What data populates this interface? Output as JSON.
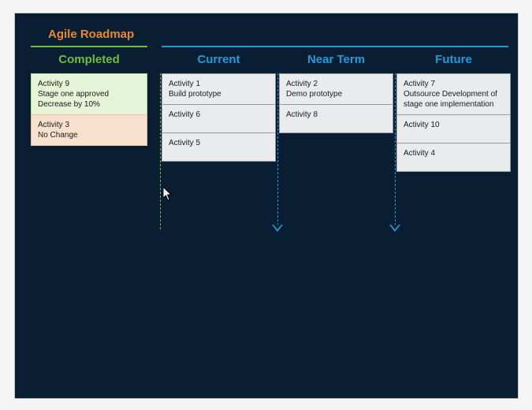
{
  "title": "Agile Roadmap",
  "columns": {
    "completed": {
      "header": "Completed",
      "cards": [
        {
          "title": "Activity 9",
          "desc1": "Stage one approved",
          "desc2": "Decrease by 10%",
          "tone": "green"
        },
        {
          "title": "Activity 3",
          "desc1": "No Change",
          "desc2": "",
          "tone": "orange"
        }
      ]
    },
    "current": {
      "header": "Current",
      "cards": [
        {
          "title": "Activity 1",
          "desc1": "Build prototype",
          "desc2": ""
        },
        {
          "title": "Activity 6",
          "desc1": "",
          "desc2": ""
        },
        {
          "title": "Activity 5",
          "desc1": "",
          "desc2": ""
        }
      ]
    },
    "near": {
      "header": "Near Term",
      "cards": [
        {
          "title": "Activity 2",
          "desc1": "Demo prototype",
          "desc2": ""
        },
        {
          "title": "Activity 8",
          "desc1": "",
          "desc2": ""
        }
      ]
    },
    "future": {
      "header": "Future",
      "cards": [
        {
          "title": "Activity 7",
          "desc1": "Outsource Development of stage one implementation",
          "desc2": ""
        },
        {
          "title": "Activity 10",
          "desc1": "",
          "desc2": ""
        },
        {
          "title": "Activity 4",
          "desc1": "",
          "desc2": ""
        }
      ]
    }
  },
  "colors": {
    "background": "#0a1e33",
    "title": "#e88a2a",
    "green": "#6fbf3f",
    "blue": "#1f9bd8",
    "card_green": "#e6f4d8",
    "card_orange": "#f8e0ce",
    "card_gray": "#e9ebec"
  }
}
